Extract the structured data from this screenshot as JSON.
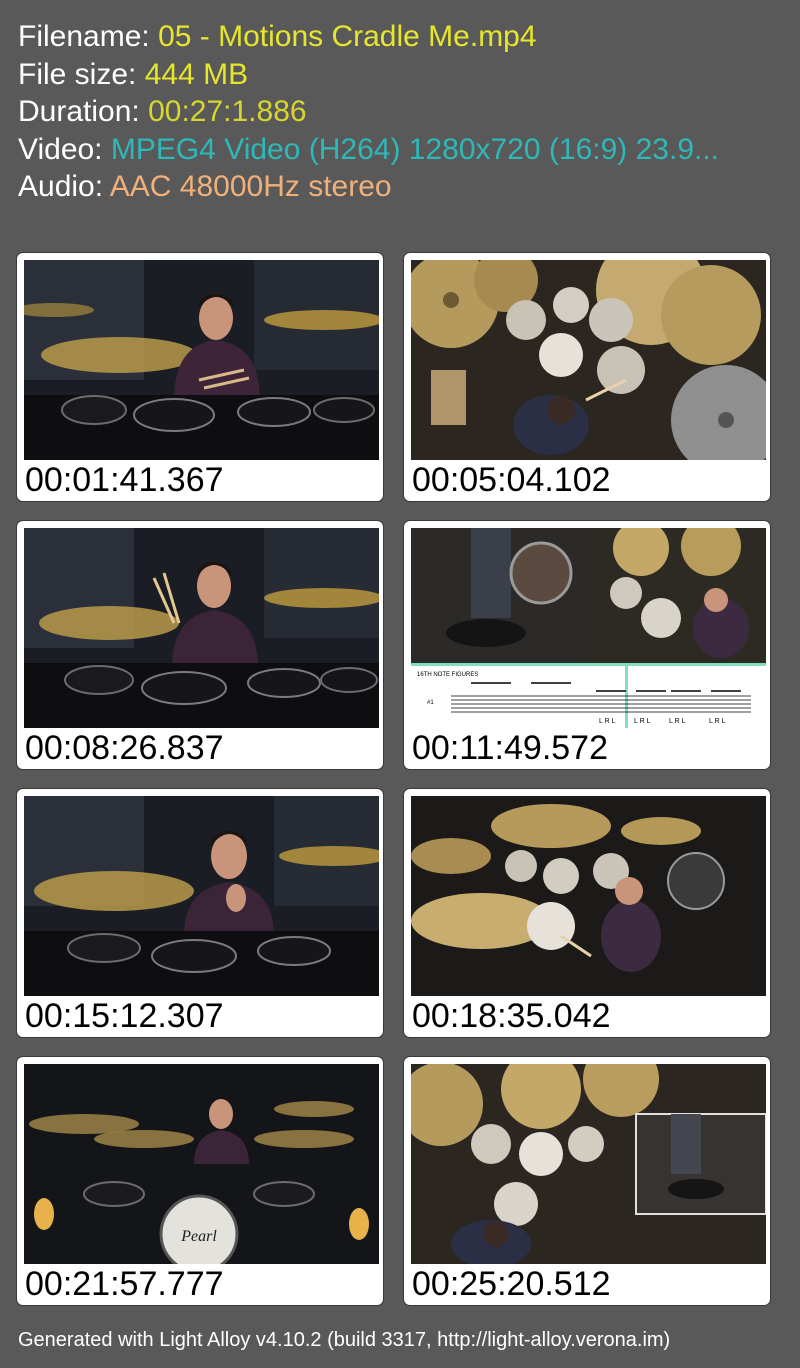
{
  "info": {
    "filename": {
      "label": "Filename: ",
      "value": "05 - Motions  Cradle Me.mp4",
      "color": "#e6e62e"
    },
    "filesize": {
      "label": "File size: ",
      "value": "444 MB",
      "color": "#e6e62e"
    },
    "duration": {
      "label": "Duration: ",
      "value": "00:27:1.886",
      "color": "#d6d62e"
    },
    "video": {
      "label": "Video: ",
      "value": "MPEG4 Video (H264) 1280x720 (16:9) 23.9...",
      "color": "#2eb8b8"
    },
    "audio": {
      "label": "Audio: ",
      "value": "AAC 48000Hz stereo",
      "color": "#f0b07a"
    }
  },
  "thumbnails": [
    {
      "timestamp": "00:01:41.367",
      "scene": "drummer talking front view"
    },
    {
      "timestamp": "00:05:04.102",
      "scene": "overhead drum kit view"
    },
    {
      "timestamp": "00:08:26.837",
      "scene": "drummer raising sticks front view"
    },
    {
      "timestamp": "00:11:49.572",
      "scene": "split view with notation",
      "notation_title": "16TH NOTE FIGURES",
      "notation_number": "#1",
      "sticking": [
        "L R L",
        "L R L",
        "L R L",
        "L R L"
      ]
    },
    {
      "timestamp": "00:15:12.307",
      "scene": "drummer gesturing front view"
    },
    {
      "timestamp": "00:18:35.042",
      "scene": "overhead angled kit view"
    },
    {
      "timestamp": "00:21:57.777",
      "scene": "wide kit view with lamps",
      "bass_drum_logo": "Pearl"
    },
    {
      "timestamp": "00:25:20.512",
      "scene": "overhead view with pedal inset"
    }
  ],
  "footer": "Generated with Light Alloy v4.10.2 (build 3317, http://light-alloy.verona.im)"
}
